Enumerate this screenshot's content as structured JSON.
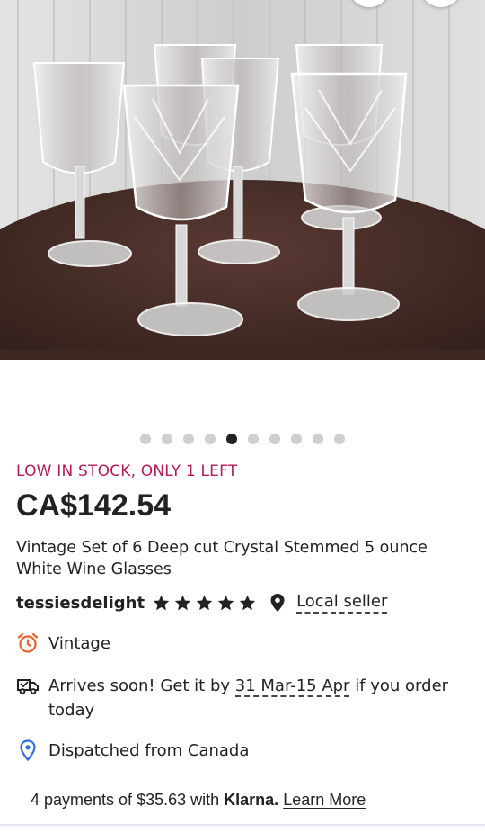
{
  "listing": {
    "stock_notice": "LOW IN STOCK, ONLY 1 LEFT",
    "price": "CA$142.54",
    "title": "Vintage Set of 6 Deep cut Crystal Stemmed 5 ounce White Wine Glasses",
    "seller": "tessiesdelight",
    "rating_stars": 5,
    "local_seller_label": "Local seller"
  },
  "gallery": {
    "image_count": 10,
    "active_index": 4,
    "image_icon": "crystal-wine-glasses-photo"
  },
  "details": {
    "vintage_label": "Vintage",
    "arrival_prefix": "Arrives soon! Get it by ",
    "arrival_dates": "31 Mar-15 Apr",
    "arrival_suffix": " if you order today",
    "dispatch": "Dispatched from Canada"
  },
  "payment": {
    "prefix": "4 payments of $35.63 with ",
    "provider": "Klarna.",
    "learn_more": "Learn More"
  },
  "colors": {
    "stock_accent": "#b5195b",
    "vintage_icon": "#e8612c",
    "dispatch_icon": "#2f6fd6",
    "text": "#222222"
  }
}
